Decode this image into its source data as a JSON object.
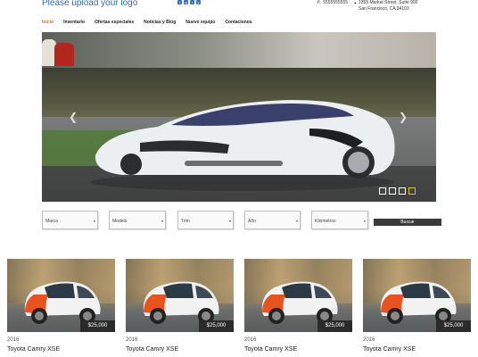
{
  "header": {
    "logo_text": "Please upload your logo",
    "social": [
      "f",
      "g",
      "t",
      "y"
    ],
    "phone": "5555555555",
    "address_line1": "1355 Market Street, Suite 900",
    "address_line2": "San Francisco, CA 94103"
  },
  "nav": {
    "items": [
      "Inicio",
      "Inventario",
      "Ofertas especiales",
      "Noticias y Blog",
      "Nuevo equipo",
      "Contactenos"
    ]
  },
  "hero": {
    "prev_icon": "chevron-left-icon",
    "next_icon": "chevron-right-icon",
    "slide_count": 4,
    "active_slide": 4
  },
  "filters": {
    "selects": [
      "Marca",
      "Modelo",
      "Trim",
      "Año",
      "Kilometros"
    ],
    "search_label": "Buscar"
  },
  "listings": [
    {
      "year": "2016",
      "model": "Toyota Camry XSE",
      "price": "$25,000"
    },
    {
      "year": "2016",
      "model": "Toyota Camry XSE",
      "price": "$25,000"
    },
    {
      "year": "2016",
      "model": "Toyota Camry XSE",
      "price": "$25,000"
    },
    {
      "year": "2016",
      "model": "Toyota Camry XSE",
      "price": "$25,000"
    }
  ],
  "colors": {
    "accent": "#2f6db5",
    "nav_active": "#c47d00",
    "dark_button": "#3a3a3a",
    "car_orange": "#e8531f"
  }
}
